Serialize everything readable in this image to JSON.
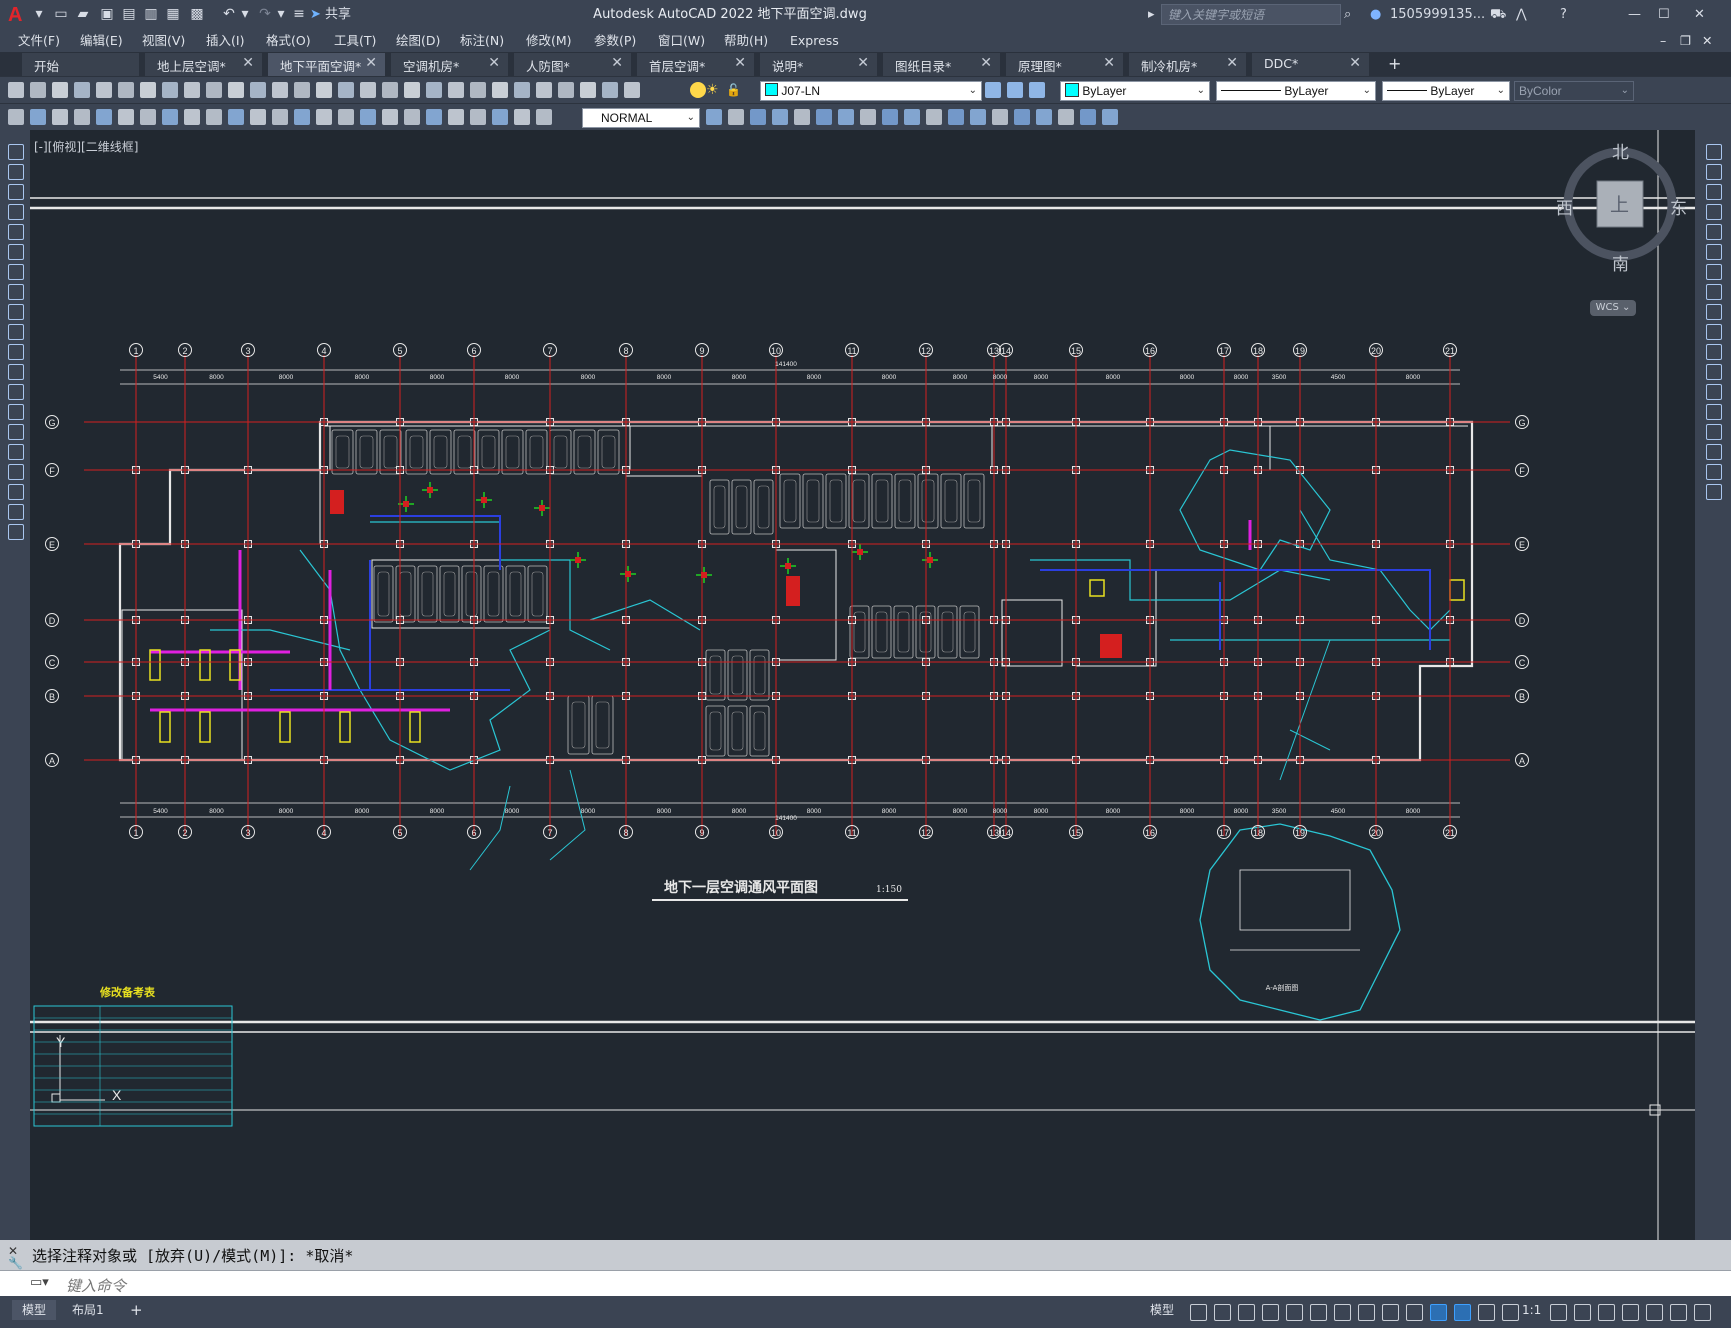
{
  "app": {
    "title": "Autodesk AutoCAD 2022    地下平面空调.dwg",
    "share_label": "共享",
    "search_placeholder": "键入关键字或短语",
    "user": "1505999135...",
    "help": "?"
  },
  "menu": [
    "文件(F)",
    "编辑(E)",
    "视图(V)",
    "插入(I)",
    "格式(O)",
    "工具(T)",
    "绘图(D)",
    "标注(N)",
    "修改(M)",
    "参数(P)",
    "窗口(W)",
    "帮助(H)",
    "Express"
  ],
  "tabs": [
    {
      "label": "开始",
      "close": false,
      "active": false
    },
    {
      "label": "地上层空调*",
      "close": true,
      "active": false
    },
    {
      "label": "地下平面空调*",
      "close": true,
      "active": true
    },
    {
      "label": "空调机房*",
      "close": true,
      "active": false
    },
    {
      "label": "人防图*",
      "close": true,
      "active": false
    },
    {
      "label": "首层空调*",
      "close": true,
      "active": false
    },
    {
      "label": "说明*",
      "close": true,
      "active": false
    },
    {
      "label": "图纸目录*",
      "close": true,
      "active": false
    },
    {
      "label": "原理图*",
      "close": true,
      "active": false
    },
    {
      "label": "制冷机房*",
      "close": true,
      "active": false
    },
    {
      "label": "DDC*",
      "close": true,
      "active": false
    }
  ],
  "properties": {
    "layer": "J07-LN",
    "color": "ByLayer",
    "linetype": "ByLayer",
    "lineweight": "ByLayer",
    "plotstyle": "ByColor",
    "dimstyle": "NORMAL"
  },
  "viewport_label": "[-][俯视][二维线框]",
  "viewcube": {
    "north": "北",
    "south": "南",
    "east": "东",
    "west": "西",
    "top": "上",
    "wcs": "WCS"
  },
  "drawing": {
    "plan_title": "地下一层空调通风平面图",
    "plan_scale": "1:150",
    "legend_title": "修改备考表",
    "detail_title": "A-A剖面图",
    "column_labels": [
      "1",
      "2",
      "3",
      "4",
      "5",
      "6",
      "7",
      "8",
      "9",
      "10",
      "11",
      "12",
      "13",
      "14",
      "15",
      "16",
      "17",
      "18",
      "19",
      "20",
      "21"
    ],
    "row_labels": [
      "G",
      "F",
      "E",
      "D",
      "C",
      "B",
      "A"
    ],
    "top_dims": [
      "5400",
      "8000",
      "8000",
      "8000",
      "8000",
      "8000",
      "8000",
      "8000",
      "8000",
      "8000",
      "8000",
      "8000",
      "8000",
      "8000",
      "8000",
      "8000",
      "8000",
      "3500",
      "4500",
      "8000",
      "8000"
    ],
    "overall_dim": "141400"
  },
  "command": {
    "history": "选择注释对象或 [放弃(U)/模式(M)]: *取消*",
    "placeholder": "键入命令"
  },
  "status": {
    "layout_tabs": [
      "模型",
      "布局1"
    ],
    "model_label": "模型",
    "scale": "1:1"
  },
  "colors": {
    "background": "#212830",
    "grid_red": "#d41f1f",
    "duct_cyan": "#2ac6d4",
    "wall_white": "#e8e8e8",
    "duct_blue": "#2b3fe0",
    "magenta": "#e020e0",
    "yellow": "#e8e020",
    "green": "#20d020"
  }
}
